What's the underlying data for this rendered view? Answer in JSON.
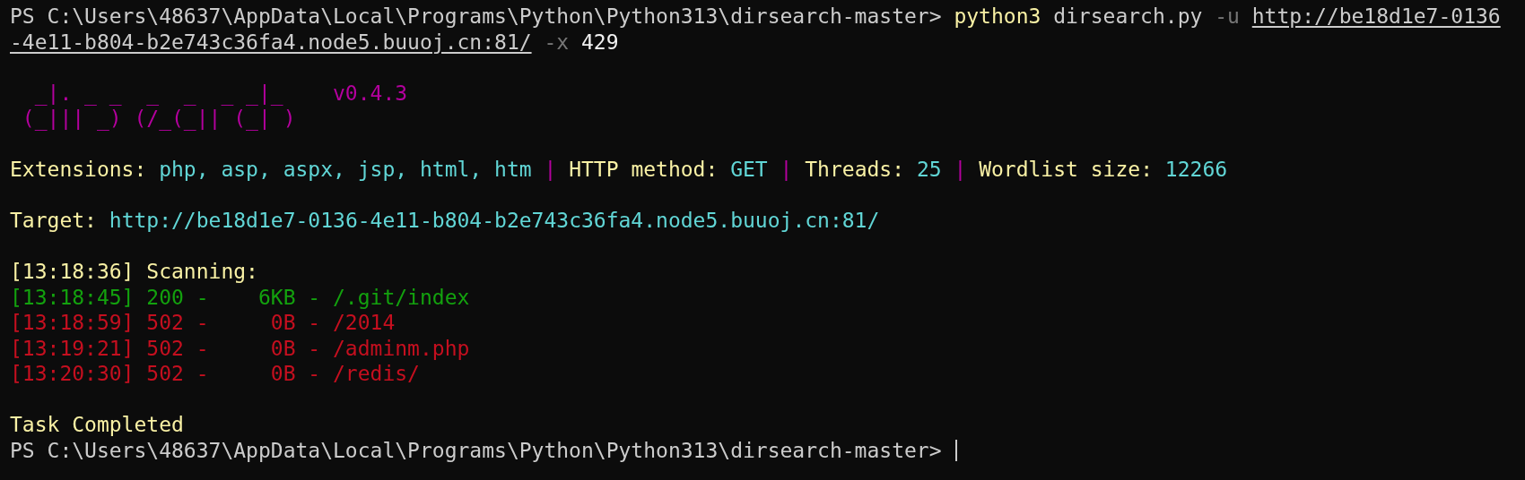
{
  "terminal": {
    "lines": [
      {
        "kind": "text",
        "segments": [
          {
            "text": "PS C:\\Users\\48637\\AppData\\Local\\Programs\\Python\\Python313\\dirsearch-master> ",
            "color": "#cccccc"
          },
          {
            "text": "python3",
            "color": "#f9f1a5"
          },
          {
            "text": " dirsearch.py ",
            "color": "#cccccc"
          },
          {
            "text": "-u ",
            "color": "#767676"
          },
          {
            "text": "http://be18d1e7-0136",
            "color": "#cccccc",
            "underlined": true
          }
        ]
      },
      {
        "kind": "text",
        "segments": [
          {
            "text": "-4e11-b804-b2e743c36fa4.node5.buuoj.cn:81/",
            "color": "#cccccc",
            "underlined": true
          },
          {
            "text": " -x",
            "color": "#767676"
          },
          {
            "text": " 429",
            "color": "#f2f2f2"
          }
        ]
      },
      {
        "kind": "blank"
      },
      {
        "kind": "text",
        "segments": [
          {
            "text": "  _|. _ _  _  _  _ _|_    v0.4.3",
            "color": "#b4009e"
          }
        ]
      },
      {
        "kind": "text",
        "segments": [
          {
            "text": " (_||| _) (/_(_|| (_| )",
            "color": "#b4009e"
          }
        ]
      },
      {
        "kind": "blank"
      },
      {
        "kind": "text",
        "segments": [
          {
            "text": "Extensions: ",
            "color": "#f9f1a5"
          },
          {
            "text": "php, asp, aspx, jsp, html, htm",
            "color": "#61d6d6"
          },
          {
            "text": " | ",
            "color": "#b4009e"
          },
          {
            "text": "HTTP method: ",
            "color": "#f9f1a5"
          },
          {
            "text": "GET",
            "color": "#61d6d6"
          },
          {
            "text": " | ",
            "color": "#b4009e"
          },
          {
            "text": "Threads: ",
            "color": "#f9f1a5"
          },
          {
            "text": "25",
            "color": "#61d6d6"
          },
          {
            "text": " | ",
            "color": "#b4009e"
          },
          {
            "text": "Wordlist size: ",
            "color": "#f9f1a5"
          },
          {
            "text": "12266",
            "color": "#61d6d6"
          }
        ]
      },
      {
        "kind": "blank"
      },
      {
        "kind": "text",
        "segments": [
          {
            "text": "Target: ",
            "color": "#f9f1a5"
          },
          {
            "text": "http://be18d1e7-0136-4e11-b804-b2e743c36fa4.node5.buuoj.cn:81/",
            "color": "#61d6d6"
          }
        ]
      },
      {
        "kind": "blank"
      },
      {
        "kind": "text",
        "segments": [
          {
            "text": "[13:18:36] Scanning:",
            "color": "#f9f1a5"
          }
        ]
      },
      {
        "kind": "text",
        "segments": [
          {
            "text": "[13:18:45] 200 -    6KB - /.git/index",
            "color": "#13a10e"
          }
        ]
      },
      {
        "kind": "text",
        "segments": [
          {
            "text": "[13:18:59] 502 -     0B - /2014",
            "color": "#c50f1f"
          }
        ]
      },
      {
        "kind": "text",
        "segments": [
          {
            "text": "[13:19:21] 502 -     0B - /adminm.php",
            "color": "#c50f1f"
          }
        ]
      },
      {
        "kind": "text",
        "segments": [
          {
            "text": "[13:20:30] 502 -     0B - /redis/",
            "color": "#c50f1f"
          }
        ]
      },
      {
        "kind": "blank"
      },
      {
        "kind": "text",
        "segments": [
          {
            "text": "Task Completed",
            "color": "#f9f1a5"
          }
        ]
      },
      {
        "kind": "prompt",
        "segments": [
          {
            "text": "PS C:\\Users\\48637\\AppData\\Local\\Programs\\Python\\Python313\\dirsearch-master> ",
            "color": "#cccccc"
          }
        ]
      }
    ]
  }
}
